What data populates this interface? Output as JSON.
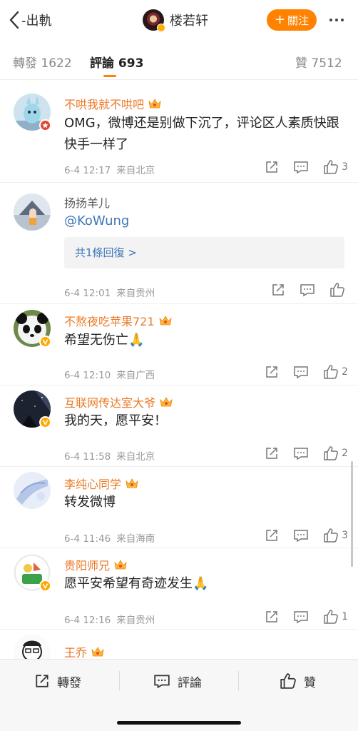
{
  "header": {
    "back_label": "-出軌",
    "account_name": "楼若轩",
    "follow_label": "關注",
    "follow_plus": "+"
  },
  "tabs": [
    {
      "label": "轉發",
      "count": "1622"
    },
    {
      "label": "評論",
      "count": "693"
    },
    {
      "label": "贊",
      "count": "7512"
    }
  ],
  "comments": [
    {
      "user": "不哄我就不哄吧",
      "text": "OMG，微博还是别做下沉了，评论区人素质快跟快手一样了",
      "time": "6-4 12:17",
      "source": "来自北京",
      "likes": "3",
      "vip": true
    },
    {
      "user": "扬扬羊儿",
      "text": "@KoWung",
      "reply_label": "共1條回復 >",
      "time": "6-4 12:01",
      "source": "来自贵州",
      "likes": "",
      "vip": false
    },
    {
      "user": "不熬夜吃苹果721",
      "text": "希望无伤亡🙏",
      "time": "6-4 12:10",
      "source": "来自广西",
      "likes": "2",
      "vip": true
    },
    {
      "user": "互联网传达室大爷",
      "text": "我的天，愿平安！",
      "time": "6-4 11:58",
      "source": "来自北京",
      "likes": "2",
      "vip": true
    },
    {
      "user": "李纯心同学",
      "text": "转发微博",
      "time": "6-4 11:46",
      "source": "来自海南",
      "likes": "3",
      "vip": true
    },
    {
      "user": "贵阳师兄",
      "text": "愿平安希望有奇迹发生🙏",
      "time": "6-4 12:16",
      "source": "来自贵州",
      "likes": "1",
      "vip": true
    },
    {
      "user": "王乔",
      "text": "",
      "vip": true
    }
  ],
  "bottom_bar": {
    "repost_label": "轉發",
    "comment_label": "評論",
    "like_label": "贊"
  },
  "colors": {
    "accent": "#ff8200",
    "username": "#ea7a26",
    "link": "#3d77b7"
  }
}
